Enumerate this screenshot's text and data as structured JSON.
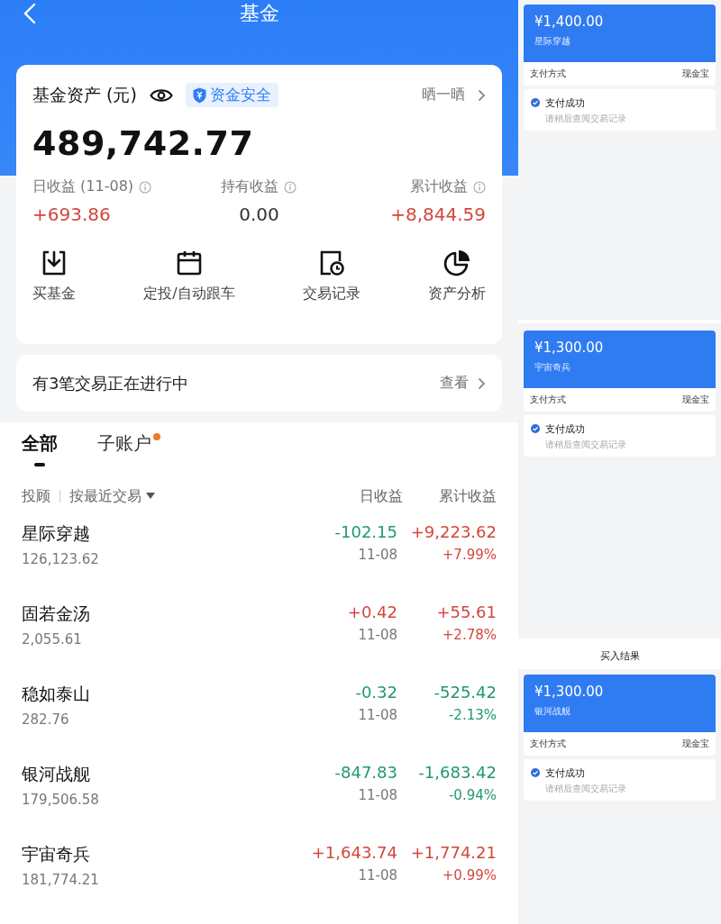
{
  "nav": {
    "title": "基金"
  },
  "asset_card": {
    "title": "基金资产 (元)",
    "badge": "资金安全",
    "share": "晒一晒",
    "total": "489,742.77",
    "stats": [
      {
        "label": "日收益 (11-08)",
        "value": "+693.86",
        "color": "#d4463c"
      },
      {
        "label": "持有收益",
        "value": "0.00",
        "color": "#333333"
      },
      {
        "label": "累计收益",
        "value": "+8,844.59",
        "color": "#d4463c"
      }
    ],
    "actions": [
      {
        "label": "买基金",
        "kind": "download"
      },
      {
        "label": "定投/自动跟车",
        "kind": "calendar"
      },
      {
        "label": "交易记录",
        "kind": "record"
      },
      {
        "label": "资产分析",
        "kind": "pie"
      }
    ]
  },
  "pending": {
    "text": "有3笔交易正在进行中",
    "link": "查看"
  },
  "tabs": [
    {
      "label": "全部",
      "selected": true,
      "dot": false
    },
    {
      "label": "子账户",
      "selected": false,
      "dot": true
    }
  ],
  "filter": {
    "advisor": "投顾",
    "sort": "按最近交易",
    "columns": [
      "日收益",
      "累计收益"
    ]
  },
  "funds": [
    {
      "name": "星际穿越",
      "amount": "126,123.62",
      "daily": {
        "value": "-102.15",
        "color": "#1f9a6c"
      },
      "date": "11-08",
      "total": {
        "value": "+9,223.62",
        "rate": "+7.99%",
        "color": "#d4463c"
      }
    },
    {
      "name": "固若金汤",
      "amount": "2,055.61",
      "daily": {
        "value": "+0.42",
        "color": "#d4463c"
      },
      "date": "11-08",
      "total": {
        "value": "+55.61",
        "rate": "+2.78%",
        "color": "#d4463c"
      }
    },
    {
      "name": "稳如泰山",
      "amount": "282.76",
      "daily": {
        "value": "-0.32",
        "color": "#1f9a6c"
      },
      "date": "11-08",
      "total": {
        "value": "-525.42",
        "rate": "-2.13%",
        "color": "#1f9a6c"
      }
    },
    {
      "name": "银河战舰",
      "amount": "179,506.58",
      "daily": {
        "value": "-847.83",
        "color": "#1f9a6c"
      },
      "date": "11-08",
      "total": {
        "value": "-1,683.42",
        "rate": "-0.94%",
        "color": "#1f9a6c"
      }
    },
    {
      "name": "宇宙奇兵",
      "amount": "181,774.21",
      "daily": {
        "value": "+1,643.74",
        "color": "#d4463c"
      },
      "date": "11-08",
      "total": {
        "value": "+1,774.21",
        "rate": "+0.99%",
        "color": "#d4463c"
      }
    }
  ],
  "receipts": [
    {
      "amount": "¥1,400.00",
      "fund": "星际穿越",
      "pay_label": "支付方式",
      "pay_method": "现金宝",
      "status": "支付成功",
      "note": "请稍后查阅交易记录"
    },
    {
      "amount": "¥1,300.00",
      "fund": "宇宙奇兵",
      "pay_label": "支付方式",
      "pay_method": "现金宝",
      "status": "支付成功",
      "note": "请稍后查阅交易记录"
    },
    {
      "heading": "买入结果",
      "amount": "¥1,300.00",
      "fund": "银河战舰",
      "pay_label": "支付方式",
      "pay_method": "现金宝",
      "status": "支付成功",
      "note": "请稍后查阅交易记录"
    }
  ]
}
